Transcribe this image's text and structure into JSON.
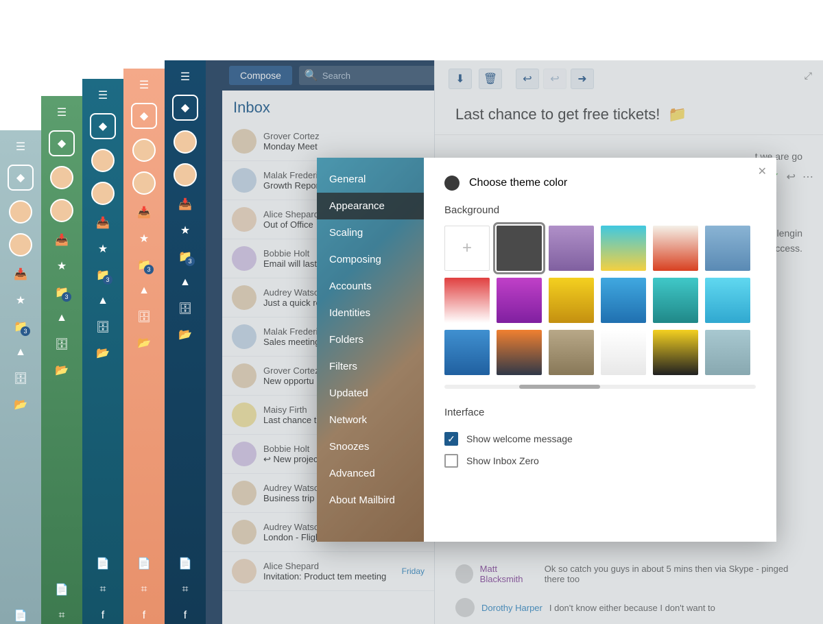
{
  "stackedSidebars": {
    "badgeCount": "3"
  },
  "app": {
    "compose": "Compose",
    "searchPlaceholder": "Search",
    "inboxTitle": "Inbox",
    "readSubject": "Last chance to get free tickets!",
    "bodyFrag1": "t we are go",
    "bodyFrag2": "challengin",
    "bodyFrag3": "uccess.",
    "replies": [
      {
        "name": "Matt Blacksmith",
        "text": "Ok so catch you guys in about 5 mins then via Skype - pinged there too"
      },
      {
        "name": "Dorothy Harper",
        "text": "I don't know either because I don't want to"
      }
    ]
  },
  "mails": [
    {
      "sender": "Grover Cortez",
      "subject": "Monday Meet"
    },
    {
      "sender": "Malak Frederick",
      "subject": "Growth Repor"
    },
    {
      "sender": "Alice Shepard",
      "subject": "Out of Office"
    },
    {
      "sender": "Bobbie Holt",
      "subject": "Email will last"
    },
    {
      "sender": "Audrey Watson",
      "subject": "Just a quick re"
    },
    {
      "sender": "Malak Frederick",
      "subject": "Sales meeting"
    },
    {
      "sender": "Grover Cortez",
      "subject": "New opportu"
    },
    {
      "sender": "Maisy Firth",
      "subject": "Last chance to"
    },
    {
      "sender": "Bobbie Holt",
      "subject": "↩ New projec"
    },
    {
      "sender": "Audrey Watson",
      "subject": "Business trip t",
      "check": true
    },
    {
      "sender": "Audrey Watson",
      "subject": "London - Flight tickets",
      "check": true
    },
    {
      "sender": "Alice Shepard",
      "subject": "Invitation: Product tem meeting",
      "date": "Friday"
    }
  ],
  "settings": {
    "nav": [
      "General",
      "Appearance",
      "Scaling",
      "Composing",
      "Accounts",
      "Identities",
      "Folders",
      "Filters",
      "Updated",
      "Network",
      "Snoozes",
      "Advanced",
      "About Mailbird"
    ],
    "activeIndex": 1,
    "themeLabel": "Choose theme color",
    "backgroundLabel": "Background",
    "interfaceLabel": "Interface",
    "options": [
      {
        "label": "Show welcome message",
        "checked": true
      },
      {
        "label": "Show Inbox Zero",
        "checked": false
      }
    ],
    "tiles": [
      {
        "type": "add"
      },
      {
        "type": "solid",
        "color": "#4a4a4a",
        "selected": true
      },
      {
        "type": "img",
        "color": "linear-gradient(#b090c8,#8060a0)"
      },
      {
        "type": "img",
        "color": "linear-gradient(#40c8e0,#f4d040)"
      },
      {
        "type": "img",
        "color": "linear-gradient(#f4f0e8,#d84020)"
      },
      {
        "type": "img",
        "color": "linear-gradient(#8ab4d4,#5a8ab4)"
      },
      {
        "type": "img",
        "color": "linear-gradient(#e04040,#fff)"
      },
      {
        "type": "img",
        "color": "linear-gradient(#c040c8,#8020a0)"
      },
      {
        "type": "img",
        "color": "linear-gradient(#f4d020,#c49010)"
      },
      {
        "type": "img",
        "color": "linear-gradient(#40a8e0,#2070b0)"
      },
      {
        "type": "img",
        "color": "linear-gradient(#40c8c8,#208888)"
      },
      {
        "type": "img",
        "color": "linear-gradient(#60d8f0,#30a8d0)"
      },
      {
        "type": "img",
        "color": "linear-gradient(#4090d0,#2060a0)"
      },
      {
        "type": "img",
        "color": "linear-gradient(#f08030,#303848)"
      },
      {
        "type": "img",
        "color": "linear-gradient(#b8a888,#887858)"
      },
      {
        "type": "img",
        "color": "linear-gradient(#fff,#e8e8e8)"
      },
      {
        "type": "img",
        "color": "linear-gradient(#f4d020,#202020)"
      },
      {
        "type": "img",
        "color": "linear-gradient(#a8c8d0,#88a8b0)"
      }
    ]
  }
}
